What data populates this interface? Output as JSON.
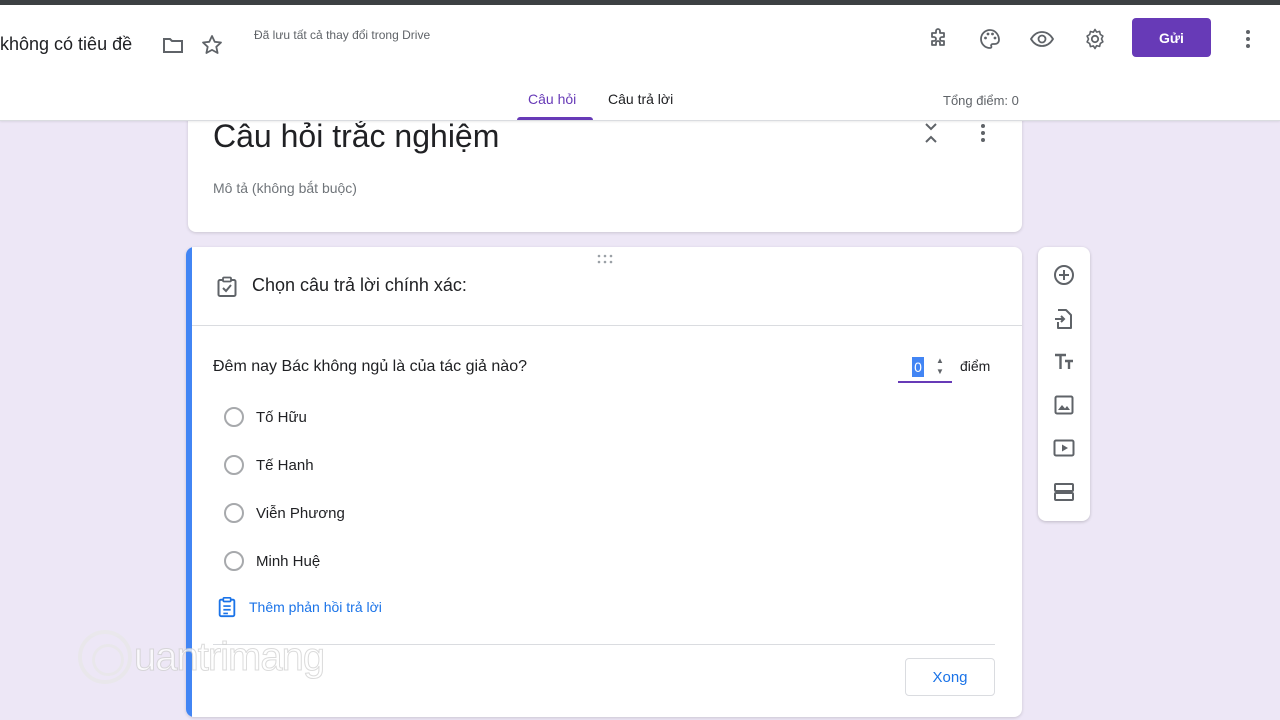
{
  "header": {
    "doc_title": "không có tiêu đề",
    "save_status": "Đã lưu tất cả thay đổi trong Drive",
    "send_label": "Gửi",
    "tabs": [
      {
        "label": "Câu hỏi",
        "active": true
      },
      {
        "label": "Câu trả lời",
        "active": false
      }
    ],
    "total_points": "Tổng điểm: 0",
    "icons": [
      "folder-icon",
      "star-icon",
      "addon-puzzle-icon",
      "palette-icon",
      "preview-eye-icon",
      "settings-gear-icon",
      "more-vert-icon"
    ]
  },
  "title_card": {
    "title": "Câu hỏi trắc nghiệm",
    "description_placeholder": "Mô tả (không bắt buộc)"
  },
  "question_card": {
    "answer_key_heading": "Chọn câu trả lời chính xác:",
    "question": "Đêm nay Bác không ngủ là của tác giả nào?",
    "points_value": "0",
    "points_label": "điểm",
    "options": [
      {
        "label": "Tố Hữu"
      },
      {
        "label": "Tế Hanh"
      },
      {
        "label": "Viễn Phương"
      },
      {
        "label": "Minh Huệ"
      }
    ],
    "feedback_label": "Thêm phản hồi trả lời",
    "done_label": "Xong"
  },
  "side_toolbar": [
    "add-question-icon",
    "import-questions-icon",
    "add-title-icon",
    "add-image-icon",
    "add-video-icon",
    "add-section-icon"
  ],
  "colors": {
    "accent": "#673ab7",
    "background": "#ede7f6",
    "focus_bar": "#4285f4",
    "link": "#1a73e8"
  },
  "watermark": "uantrimang"
}
